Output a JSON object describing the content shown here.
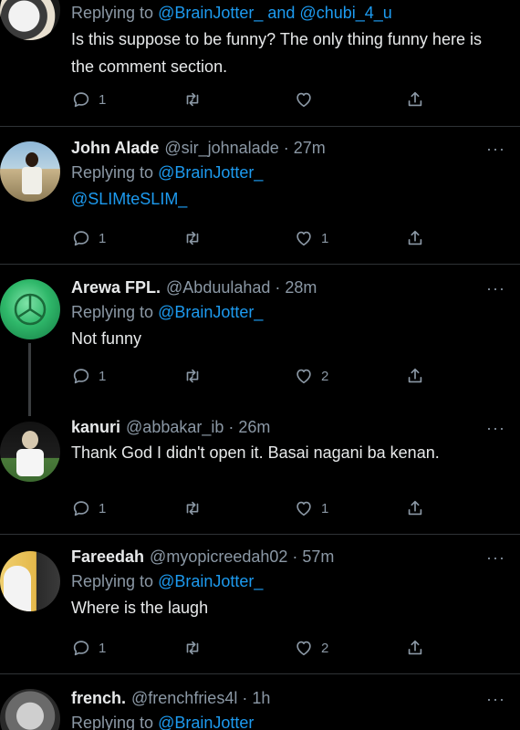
{
  "tweets": [
    {
      "name": "",
      "handle": "",
      "time": "",
      "replying_prefix": "Replying to",
      "replying_to": "@BrainJotter_ and @chubi_4_u",
      "text": "Is this suppose to be funny? The only thing funny here is the comment section.",
      "reply_count": "1",
      "retweet_count": "",
      "like_count": ""
    },
    {
      "name": "John Alade",
      "handle": "@sir_johnalade · 27m",
      "replying_prefix": "Replying to",
      "replying_to": "@BrainJotter_",
      "text": "@SLIMteSLIM_",
      "reply_count": "1",
      "retweet_count": "",
      "like_count": "1"
    },
    {
      "name": "Arewa FPL.",
      "handle": "@Abduulahad · 28m",
      "replying_prefix": "Replying to",
      "replying_to": "@BrainJotter_",
      "text": "Not funny",
      "reply_count": "1",
      "retweet_count": "",
      "like_count": "2"
    },
    {
      "name": "kanuri",
      "handle": "@abbakar_ib · 26m",
      "text": "Thank God I didn't open it. Basai nagani ba kenan.",
      "reply_count": "1",
      "retweet_count": "",
      "like_count": "1"
    },
    {
      "name": "Fareedah",
      "handle": "@myopicreedah02 · 57m",
      "replying_prefix": "Replying to",
      "replying_to": "@BrainJotter_",
      "text": "Where is the laugh",
      "reply_count": "1",
      "retweet_count": "",
      "like_count": "2"
    },
    {
      "name": "french.",
      "handle": "@frenchfries4l · 1h",
      "replying_prefix": "Replying to",
      "replying_to": "@BrainJotter"
    }
  ],
  "more_icon": "···",
  "icons": {
    "reply": "reply-icon",
    "retweet": "retweet-icon",
    "like": "heart-icon",
    "share": "share-icon",
    "more": "more-icon"
  },
  "colors": {
    "background": "#000000",
    "text": "#e7e9ea",
    "secondary": "#8b98a5",
    "link": "#1d9bf0",
    "divider": "#2f3336"
  }
}
